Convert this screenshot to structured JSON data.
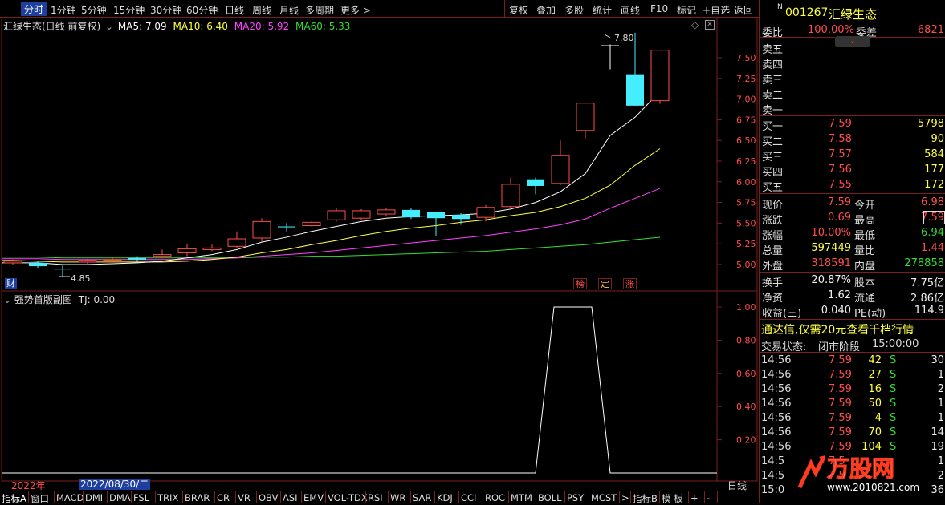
{
  "toolbar": {
    "periods": [
      "分时",
      "1分钟",
      "5分钟",
      "15分钟",
      "30分钟",
      "60分钟",
      "日线",
      "周线",
      "月线",
      "多周期",
      "更多 >"
    ],
    "active_period": "分时",
    "actions": [
      "复权",
      "叠加",
      "多股",
      "统计",
      "画线",
      "F10",
      "标记",
      "+自选",
      "返回"
    ]
  },
  "main_chart": {
    "title": "汇绿生态(日线 前复权)",
    "ma5_label": "MA5: 7.09",
    "ma10_label": "MA10: 6.40",
    "ma20_label": "MA20: 5.92",
    "ma60_label": "MA60: 5.33",
    "high_label": "7.80",
    "low_label": "4.85",
    "price_ticks": [
      "7.50",
      "7.25",
      "7.00",
      "6.75",
      "6.50",
      "6.25",
      "6.00",
      "5.75",
      "5.50",
      "5.25",
      "5.00"
    ],
    "tag_fin": "财",
    "tag_bang": "榜",
    "tag_ding": "定",
    "tag_zhang": "涨",
    "colors": {
      "ma5": "#ffffff",
      "ma10": "#ffff44",
      "ma20": "#ff44ff",
      "ma60": "#33dd33",
      "up": "#ff4d4d",
      "down": "#44eeff"
    }
  },
  "sub_chart": {
    "title": "强势首版副图",
    "tj_label": "TJ: 0.00",
    "ticks": [
      "1.00",
      "0.80",
      "0.60",
      "0.40",
      "0.20"
    ]
  },
  "axis": {
    "year_label": "2022年",
    "date_label": "2022/08/30/二",
    "period_label": "日线"
  },
  "bottom_tabs": [
    "指标A",
    "窗口",
    "MACD",
    "DMI",
    "DMA",
    "FSL",
    "TRIX",
    "BRAR",
    "CR",
    "VR",
    "OBV",
    "ASI",
    "EMV",
    "VOL-TDX",
    "RSI",
    "WR",
    "SAR",
    "KDJ",
    "CCI",
    "ROC",
    "MTM",
    "BOLL",
    "PSY",
    "MCST",
    ">",
    "指标B",
    "模 板",
    "+",
    "-"
  ],
  "quote": {
    "code": "001267",
    "name": "汇绿生态",
    "weibi_label": "委比",
    "weibi_value": "100.00%",
    "weicha_label": "委差",
    "weicha_value": "6821",
    "sell_labels": [
      "卖五",
      "卖四",
      "卖三",
      "卖二",
      "卖一"
    ],
    "buys": [
      {
        "label": "买一",
        "price": "7.59",
        "vol": "5798"
      },
      {
        "label": "买二",
        "price": "7.58",
        "vol": "90"
      },
      {
        "label": "买三",
        "price": "7.57",
        "vol": "584"
      },
      {
        "label": "买四",
        "price": "7.56",
        "vol": "177"
      },
      {
        "label": "买五",
        "price": "7.55",
        "vol": "172"
      }
    ],
    "stats": [
      {
        "l1": "现价",
        "v1": "7.59",
        "l2": "今开",
        "v2": "6.98"
      },
      {
        "l1": "涨跌",
        "v1": "0.69",
        "l2": "最高",
        "v2": "7.59"
      },
      {
        "l1": "涨幅",
        "v1": "10.00%",
        "l2": "最低",
        "v2": "6.94"
      },
      {
        "l1": "总量",
        "v1": "597449",
        "l2": "量比",
        "v2": "1.44"
      },
      {
        "l1": "外盘",
        "v1": "318591",
        "l2": "内盘",
        "v2": "278858"
      }
    ],
    "stats2": [
      {
        "l1": "换手",
        "v1": "20.87%",
        "l2": "股本",
        "v2": "7.75亿"
      },
      {
        "l1": "净资",
        "v1": "1.62",
        "l2": "流通",
        "v2": "2.86亿"
      },
      {
        "l1": "收益(三)",
        "v1": "0.040",
        "l2": "PE(动)",
        "v2": "114.9"
      }
    ],
    "promo": "通达信,仅需20元查看千档行情",
    "trade_status_label": "交易状态:",
    "trade_status_value": "闭市阶段",
    "trade_time": "15:00:00",
    "ticks": [
      {
        "t": "14:56",
        "p": "7.59",
        "v": "42",
        "s": "S",
        "n": "30"
      },
      {
        "t": "14:56",
        "p": "7.59",
        "v": "27",
        "s": "S",
        "n": "1"
      },
      {
        "t": "14:56",
        "p": "7.59",
        "v": "16",
        "s": "S",
        "n": "2"
      },
      {
        "t": "14:56",
        "p": "7.59",
        "v": "50",
        "s": "S",
        "n": "1"
      },
      {
        "t": "14:56",
        "p": "7.59",
        "v": "4",
        "s": "S",
        "n": "1"
      },
      {
        "t": "14:56",
        "p": "7.59",
        "v": "70",
        "s": "S",
        "n": "14"
      },
      {
        "t": "14:56",
        "p": "7.59",
        "v": "104",
        "s": "S",
        "n": "19"
      },
      {
        "t": "14:5",
        "p": "7.5",
        "v": "",
        "s": "",
        "n": "1"
      },
      {
        "t": "14:5",
        "p": "7.5",
        "v": "",
        "s": "",
        "n": "2"
      },
      {
        "t": "15:0",
        "p": "",
        "v": "",
        "s": "",
        "n": "36"
      }
    ],
    "watermark": "万股网",
    "watermark_url": "www.2010821.com"
  },
  "chart_data": {
    "type": "candlestick",
    "candles": [
      {
        "o": 5.02,
        "c": 5.04,
        "h": 5.06,
        "l": 5.0
      },
      {
        "o": 5.02,
        "c": 4.98,
        "h": 5.04,
        "l": 4.96
      },
      {
        "o": 4.95,
        "c": 4.94,
        "h": 5.0,
        "l": 4.85
      },
      {
        "o": 5.03,
        "c": 5.05,
        "h": 5.07,
        "l": 5.01
      },
      {
        "o": 5.05,
        "c": 5.06,
        "h": 5.09,
        "l": 5.03
      },
      {
        "o": 5.08,
        "c": 5.06,
        "h": 5.1,
        "l": 5.03
      },
      {
        "o": 5.1,
        "c": 5.12,
        "h": 5.18,
        "l": 5.08
      },
      {
        "o": 5.14,
        "c": 5.19,
        "h": 5.25,
        "l": 5.1
      },
      {
        "o": 5.18,
        "c": 5.2,
        "h": 5.24,
        "l": 5.16
      },
      {
        "o": 5.22,
        "c": 5.31,
        "h": 5.4,
        "l": 5.2
      },
      {
        "o": 5.32,
        "c": 5.52,
        "h": 5.56,
        "l": 5.28
      },
      {
        "o": 5.46,
        "c": 5.45,
        "h": 5.5,
        "l": 5.4
      },
      {
        "o": 5.47,
        "c": 5.51,
        "h": 5.52,
        "l": 5.46
      },
      {
        "o": 5.54,
        "c": 5.65,
        "h": 5.68,
        "l": 5.52
      },
      {
        "o": 5.56,
        "c": 5.65,
        "h": 5.67,
        "l": 5.54
      },
      {
        "o": 5.61,
        "c": 5.66,
        "h": 5.68,
        "l": 5.58
      },
      {
        "o": 5.66,
        "c": 5.57,
        "h": 5.68,
        "l": 5.55
      },
      {
        "o": 5.63,
        "c": 5.56,
        "h": 5.63,
        "l": 5.35
      },
      {
        "o": 5.6,
        "c": 5.55,
        "h": 5.62,
        "l": 5.48
      },
      {
        "o": 5.57,
        "c": 5.69,
        "h": 5.72,
        "l": 5.52
      },
      {
        "o": 5.7,
        "c": 5.97,
        "h": 6.05,
        "l": 5.68
      },
      {
        "o": 6.03,
        "c": 5.95,
        "h": 6.05,
        "l": 5.85
      },
      {
        "o": 5.98,
        "c": 6.32,
        "h": 6.5,
        "l": 5.96
      },
      {
        "o": 6.62,
        "c": 6.95,
        "h": 6.96,
        "l": 6.52
      },
      {
        "o": 7.65,
        "c": 7.65,
        "h": 7.66,
        "l": 7.36
      },
      {
        "o": 7.3,
        "c": 6.92,
        "h": 7.8,
        "l": 6.92
      },
      {
        "o": 6.98,
        "c": 7.59,
        "h": 7.59,
        "l": 6.94
      }
    ],
    "ma5": [
      5.02,
      5.02,
      5.0,
      5.0,
      5.01,
      5.02,
      5.04,
      5.08,
      5.12,
      5.18,
      5.27,
      5.33,
      5.4,
      5.46,
      5.52,
      5.56,
      5.58,
      5.59,
      5.6,
      5.62,
      5.67,
      5.75,
      5.88,
      6.1,
      6.56,
      6.78,
      7.09
    ],
    "ma10": [
      5.05,
      5.04,
      5.03,
      5.03,
      5.03,
      5.03,
      5.03,
      5.04,
      5.06,
      5.09,
      5.14,
      5.18,
      5.24,
      5.29,
      5.35,
      5.4,
      5.44,
      5.47,
      5.51,
      5.54,
      5.59,
      5.63,
      5.7,
      5.8,
      5.96,
      6.2,
      6.4
    ],
    "ma20": [
      5.07,
      5.07,
      5.06,
      5.06,
      5.06,
      5.06,
      5.06,
      5.06,
      5.07,
      5.08,
      5.1,
      5.12,
      5.14,
      5.17,
      5.2,
      5.23,
      5.26,
      5.29,
      5.32,
      5.35,
      5.39,
      5.43,
      5.48,
      5.55,
      5.68,
      5.8,
      5.92
    ],
    "ma60": [
      5.09,
      5.09,
      5.08,
      5.08,
      5.08,
      5.08,
      5.08,
      5.08,
      5.08,
      5.08,
      5.09,
      5.09,
      5.1,
      5.1,
      5.11,
      5.12,
      5.13,
      5.14,
      5.15,
      5.16,
      5.18,
      5.2,
      5.22,
      5.24,
      5.27,
      5.3,
      5.33
    ],
    "tj": [
      0,
      0,
      0,
      0,
      0,
      0,
      0,
      0,
      0,
      0,
      0,
      0,
      0,
      0,
      0,
      0,
      0,
      0,
      0,
      0,
      0,
      0,
      1,
      1,
      0,
      0,
      0
    ],
    "ylim": [
      4.85,
      7.8
    ],
    "tj_ylim": [
      0,
      1.05
    ]
  }
}
